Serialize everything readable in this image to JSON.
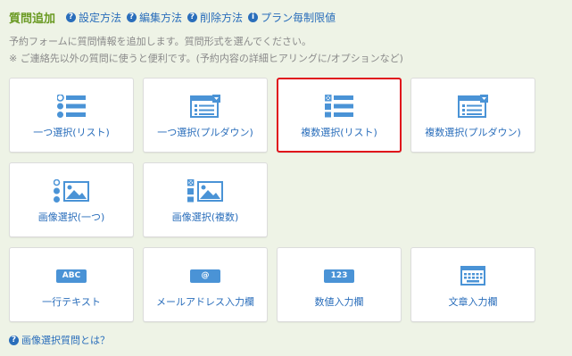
{
  "header": {
    "title": "質問追加",
    "links": [
      {
        "label": "設定方法",
        "icon": "question-icon"
      },
      {
        "label": "編集方法",
        "icon": "question-icon"
      },
      {
        "label": "削除方法",
        "icon": "question-icon"
      },
      {
        "label": "プラン毎制限値",
        "icon": "info-icon"
      }
    ]
  },
  "description": {
    "line1": "予約フォームに質問情報を追加します。質問形式を選んでください。",
    "line2": "※ ご連絡先以外の質問に使うと便利です。(予約内容の詳細ヒアリングに/オプションなど)"
  },
  "cards": [
    {
      "label": "一つ選択(リスト)",
      "icon": "radio-list-icon"
    },
    {
      "label": "一つ選択(プルダウン)",
      "icon": "dropdown-form-icon"
    },
    {
      "label": "複数選択(リスト)",
      "icon": "checkbox-list-icon",
      "selected": true
    },
    {
      "label": "複数選択(プルダウン)",
      "icon": "dropdown-form-icon"
    },
    {
      "label": "画像選択(一つ)",
      "icon": "image-radio-icon"
    },
    {
      "label": "画像選択(複数)",
      "icon": "image-checkbox-icon"
    },
    {
      "label": "一行テキスト",
      "icon": "abc-badge-icon",
      "badge": "ABC"
    },
    {
      "label": "メールアドレス入力欄",
      "icon": "at-badge-icon",
      "badge": "@"
    },
    {
      "label": "数値入力欄",
      "icon": "number-badge-icon",
      "badge": "123"
    },
    {
      "label": "文章入力欄",
      "icon": "keyboard-icon"
    }
  ],
  "footer": {
    "label": "画像選択質問とは？",
    "icon": "question-icon"
  },
  "colors": {
    "accent": "#2a6ebb",
    "title": "#6a9a23",
    "selected_border": "#e0121b",
    "icon_blue": "#4a93d6",
    "background": "#eef3e6"
  }
}
